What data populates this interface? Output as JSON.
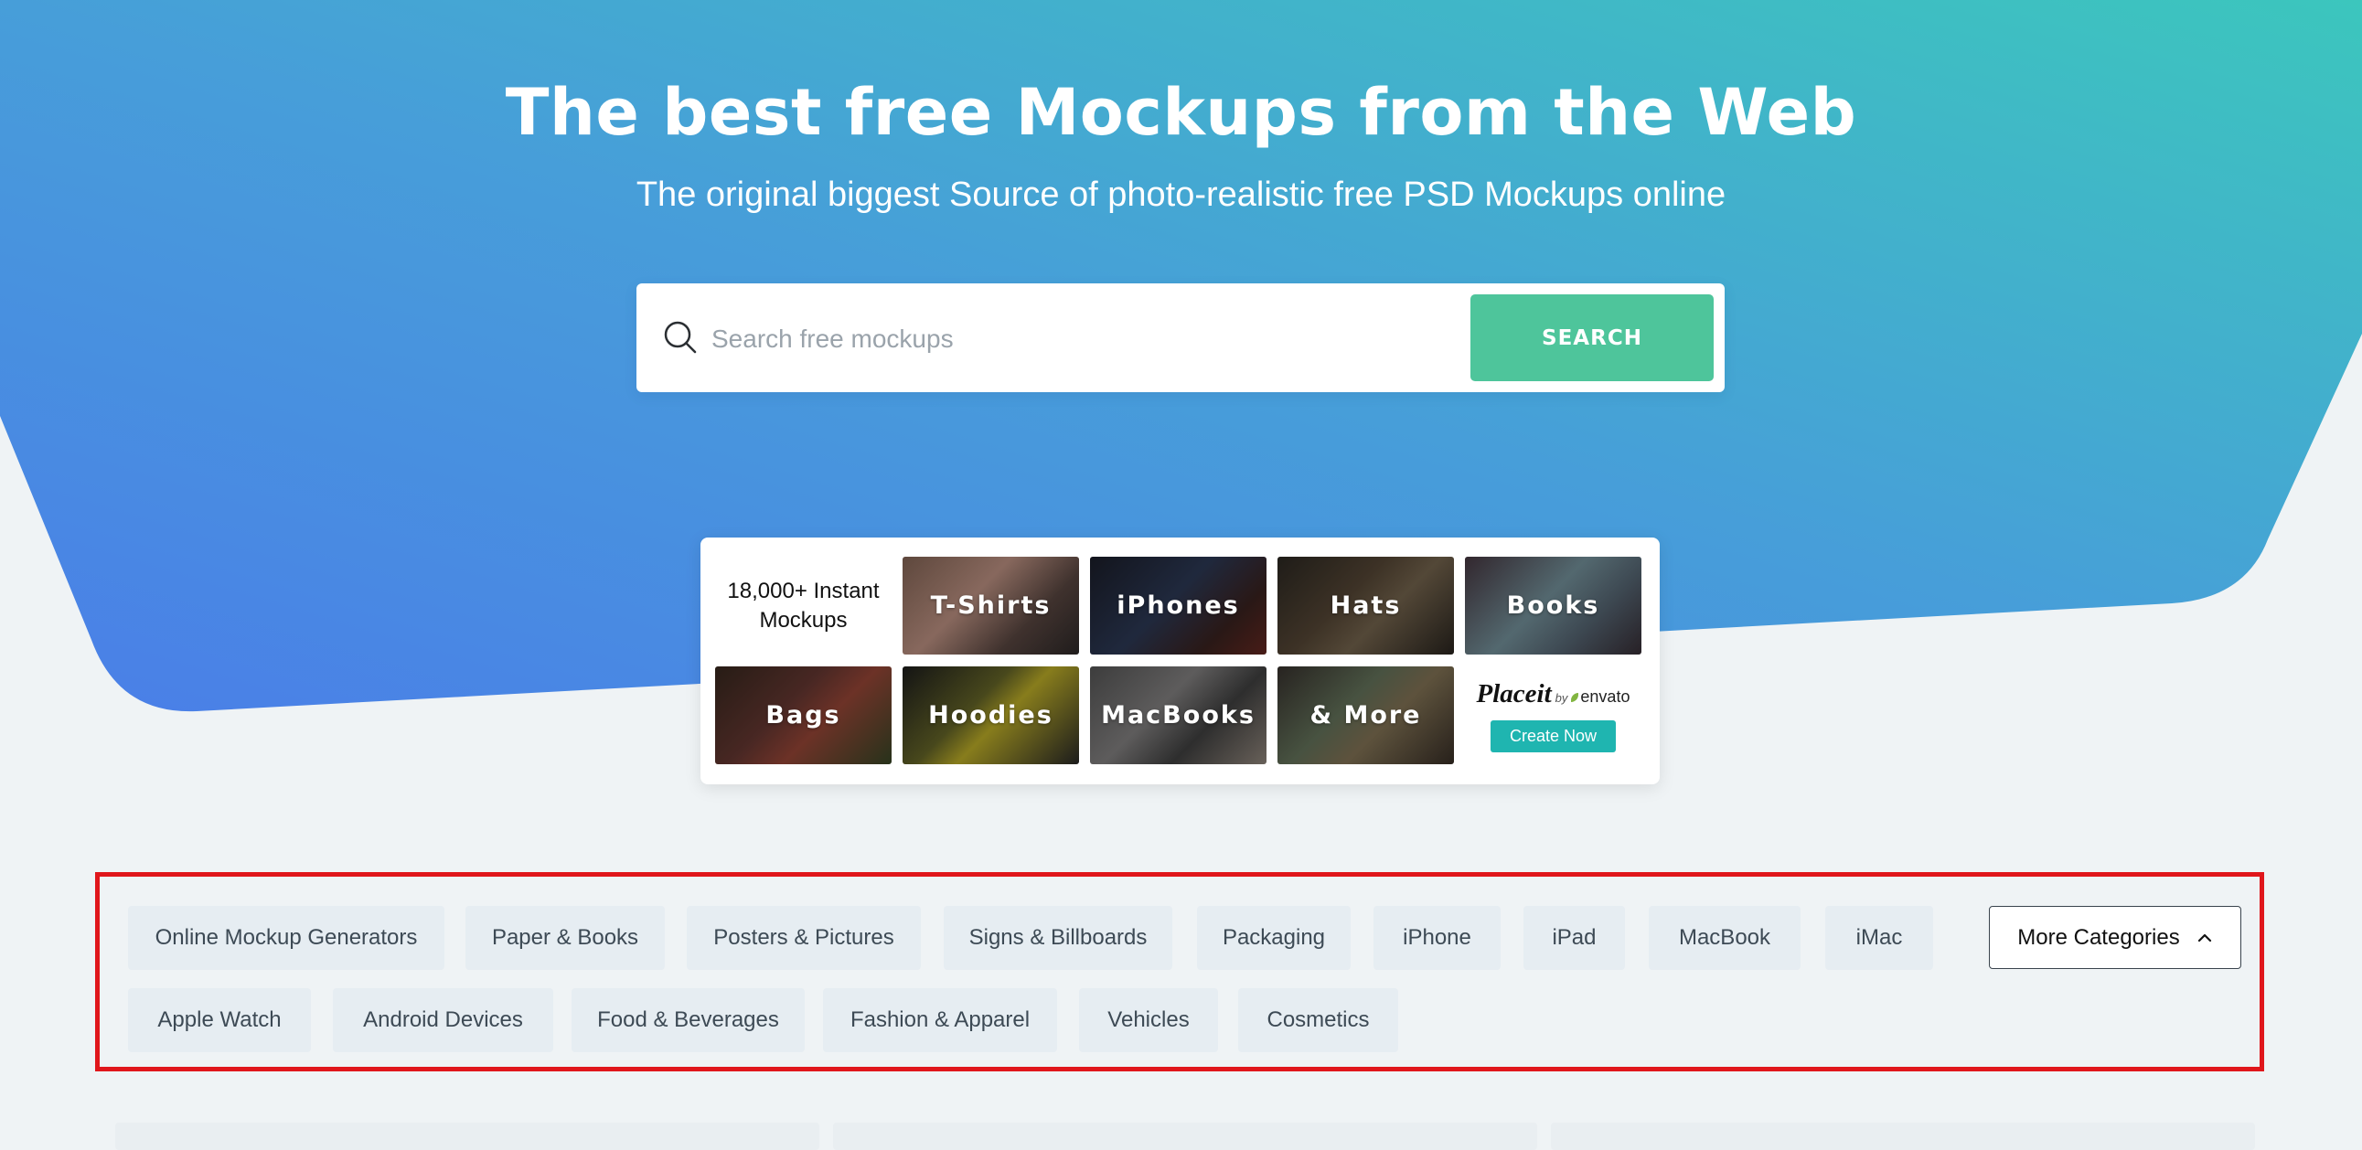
{
  "hero": {
    "title": "The best free Mockups from the Web",
    "subtitle": "The original biggest Source of photo-realistic free PSD Mockups online"
  },
  "search": {
    "placeholder": "Search free mockups",
    "button_label": "SEARCH",
    "icon": "search-icon"
  },
  "promo": {
    "intro_line1": "18,000+ Instant",
    "intro_line2": "Mockups",
    "tiles": [
      {
        "label": "T-Shirts"
      },
      {
        "label": "iPhones"
      },
      {
        "label": "Hats"
      },
      {
        "label": "Books"
      },
      {
        "label": "Bags"
      },
      {
        "label": "Hoodies"
      },
      {
        "label": "MacBooks"
      },
      {
        "label": "& More"
      }
    ],
    "placeit": {
      "word": "Placeit",
      "by": "by",
      "envato": "envato",
      "cta": "Create Now"
    }
  },
  "categories": {
    "row1": [
      {
        "label": "Online Mockup Generators"
      },
      {
        "label": "Paper & Books"
      },
      {
        "label": "Posters & Pictures"
      },
      {
        "label": "Signs & Billboards"
      },
      {
        "label": "Packaging"
      },
      {
        "label": "iPhone"
      },
      {
        "label": "iPad"
      },
      {
        "label": "MacBook"
      },
      {
        "label": "iMac"
      }
    ],
    "row2": [
      {
        "label": "Apple Watch"
      },
      {
        "label": "Android Devices"
      },
      {
        "label": "Food & Beverages"
      },
      {
        "label": "Fashion & Apparel"
      },
      {
        "label": "Vehicles"
      },
      {
        "label": "Cosmetics"
      }
    ],
    "more_label": "More Categories",
    "more_icon": "chevron-up-icon"
  },
  "colors": {
    "hero_gradient_start": "#4a7ee8",
    "hero_gradient_end": "#3cc3c0",
    "search_button": "#4ec59b",
    "placeit_button": "#1fb5b0",
    "highlight_border": "#e0161b"
  }
}
